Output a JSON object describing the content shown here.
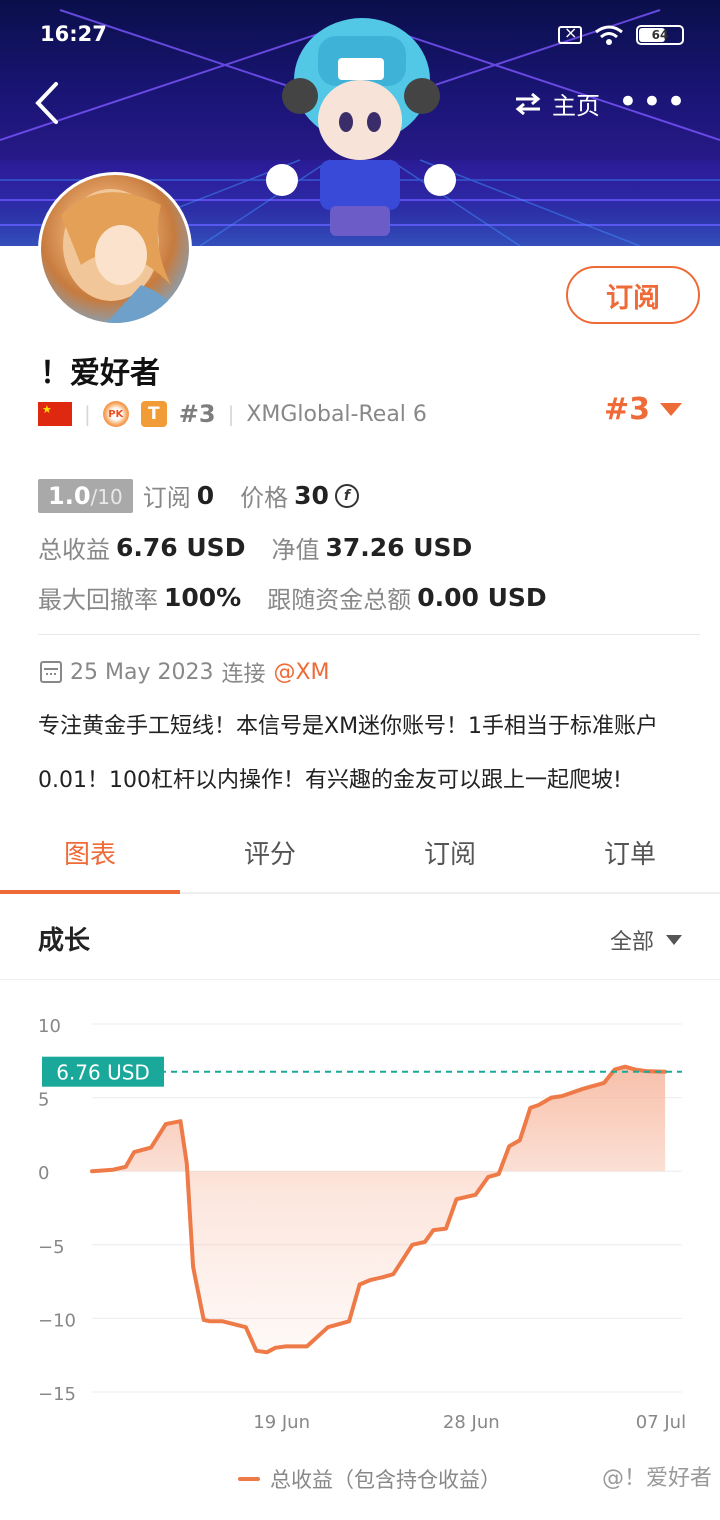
{
  "status_bar": {
    "time": "16:27",
    "battery": "64"
  },
  "nav": {
    "home_label": "主页",
    "more": "•••"
  },
  "profile": {
    "name": "！爱好者",
    "subscribe_label": "订阅",
    "pk_label": "PK",
    "tier_badge": "T",
    "rank_gray": "#3",
    "server": "XMGlobal-Real 6",
    "rank_orange": "#3",
    "score": "1.0",
    "score_max": "/10",
    "subscribe_count_label": "订阅",
    "subscribe_count": "0",
    "price_label": "价格",
    "price": "30",
    "coin_symbol": "f",
    "total_profit_label": "总收益",
    "total_profit": "6.76 USD",
    "equity_label": "净值",
    "equity": "37.26 USD",
    "drawdown_label": "最大回撤率",
    "drawdown": "100%",
    "follow_funds_label": "跟随资金总额",
    "follow_funds": "0.00 USD",
    "connect_date": "25 May 2023",
    "connect_label": "连接",
    "broker": "@XM",
    "description": "专注黄金手工短线！本信号是XM迷你账号！1手相当于标准账户0.01！100杠杆以内操作！有兴趣的金友可以跟上一起爬坡!"
  },
  "tabs": [
    {
      "label": "图表",
      "active": true
    },
    {
      "label": "评分",
      "active": false
    },
    {
      "label": "订阅",
      "active": false
    },
    {
      "label": "订单",
      "active": false
    }
  ],
  "section": {
    "title": "成长",
    "filter": "全部"
  },
  "chart_data": {
    "type": "area",
    "y_ticks": [
      "10",
      "5",
      "0",
      "−5",
      "−10",
      "−15"
    ],
    "ylim": [
      -15,
      10
    ],
    "x_ticks": [
      "19 Jun",
      "28 Jun",
      "07 Jul"
    ],
    "x_tick_days": [
      19,
      28,
      37
    ],
    "xlim": [
      10,
      38
    ],
    "current_label": "6.76 USD",
    "current_value": 6.76,
    "series": [
      {
        "name": "总收益（包含持仓收益）",
        "x": [
          10,
          11,
          11.6,
          12,
          12.8,
          13.5,
          14.2,
          14.5,
          14.8,
          15.3,
          15.6,
          16.2,
          17.3,
          17.8,
          18.3,
          18.7,
          19.2,
          20.2,
          21.2,
          22.2,
          22.7,
          23.2,
          23.8,
          24.3,
          25.2,
          25.8,
          26.2,
          26.8,
          27.3,
          28.2,
          28.8,
          29.3,
          29.8,
          30.3,
          30.8,
          31.2,
          31.8,
          32.3,
          33.3,
          34.3,
          34.8,
          35.3,
          35.8,
          36.3,
          37.2
        ],
        "values": [
          0,
          0.1,
          0.3,
          1.3,
          1.6,
          3.2,
          3.4,
          0.5,
          -6.5,
          -10.1,
          -10.2,
          -10.2,
          -10.6,
          -12.2,
          -12.3,
          -12.0,
          -11.9,
          -11.9,
          -10.6,
          -10.2,
          -7.7,
          -7.4,
          -7.2,
          -7.0,
          -5.0,
          -4.8,
          -4.0,
          -3.9,
          -1.9,
          -1.6,
          -0.4,
          -0.2,
          1.7,
          2.1,
          4.3,
          4.5,
          5.0,
          5.1,
          5.6,
          6.0,
          6.9,
          7.1,
          6.9,
          6.8,
          6.76
        ]
      }
    ],
    "grid": true,
    "line_color": "#ee7a48",
    "fill_color": "#f7b9a1",
    "marker_color": "#1aa89a"
  },
  "legend_label": "总收益（包含持仓收益）",
  "watermark": "@！爱好者",
  "colors": {
    "accent": "#ee6a37",
    "teal": "#1aa89a",
    "gray": "#888888"
  }
}
